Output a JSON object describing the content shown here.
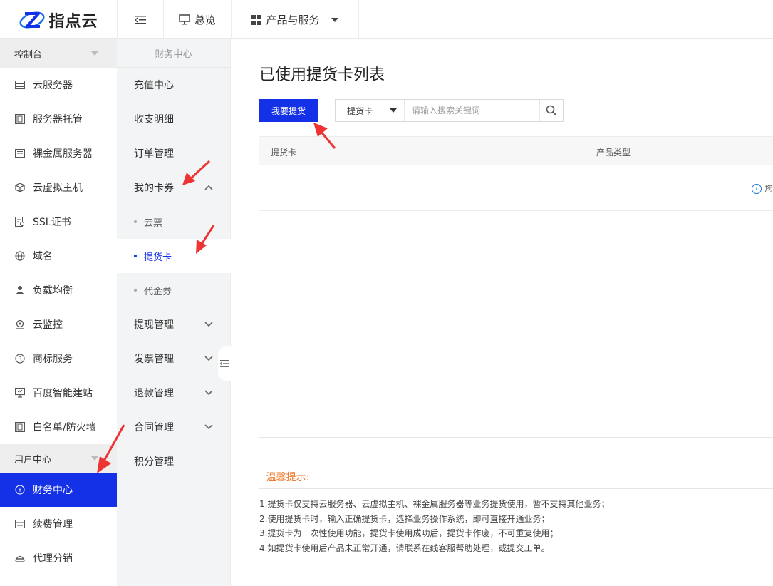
{
  "brand": {
    "name": "指点云"
  },
  "topnav": {
    "overview_label": "总览",
    "products_label": "产品与服务"
  },
  "sidebar": {
    "console_header": "控制台",
    "console_items": [
      {
        "label": "云服务器",
        "icon": "server-icon"
      },
      {
        "label": "服务器托管",
        "icon": "server-hosting-icon"
      },
      {
        "label": "裸金属服务器",
        "icon": "bare-metal-icon"
      },
      {
        "label": "云虚拟主机",
        "icon": "cube-icon"
      },
      {
        "label": "SSL证书",
        "icon": "certificate-icon"
      },
      {
        "label": "域名",
        "icon": "globe-icon"
      },
      {
        "label": "负载均衡",
        "icon": "load-balance-icon"
      },
      {
        "label": "云监控",
        "icon": "monitor-icon"
      },
      {
        "label": "商标服务",
        "icon": "trademark-icon"
      },
      {
        "label": "百度智能建站",
        "icon": "website-icon"
      },
      {
        "label": "白名单/防火墙",
        "icon": "firewall-icon"
      }
    ],
    "user_header": "用户中心",
    "user_items": [
      {
        "label": "财务中心",
        "icon": "finance-icon",
        "active": true
      },
      {
        "label": "续费管理",
        "icon": "renew-icon"
      },
      {
        "label": "代理分销",
        "icon": "agent-icon"
      }
    ]
  },
  "subnav": {
    "title": "财务中心",
    "items": {
      "recharge": "充值中心",
      "billing": "收支明细",
      "orders": "订单管理",
      "coupons": "我的卡券",
      "coupon_children": [
        "云票",
        "提货卡",
        "代金券"
      ],
      "withdraw": "提现管理",
      "invoice": "发票管理",
      "refund": "退款管理",
      "contract": "合同管理",
      "points": "积分管理"
    }
  },
  "main": {
    "title": "已使用提货卡列表",
    "primary_button": "我要提货",
    "search": {
      "select_value": "提货卡",
      "placeholder": "请输入搜索关键词"
    },
    "table": {
      "columns": [
        "提货卡",
        "产品类型"
      ],
      "empty_text": "您"
    },
    "tips": {
      "title": "温馨提示:",
      "lines": [
        "1.提货卡仅支持云服务器、云虚拟主机、裸金属服务器等业务提货使用，暂不支持其他业务；",
        "2.使用提货卡时，输入正确提货卡，选择业务操作系统，即可直接开通业务；",
        "3.提货卡为一次性使用功能，提货卡使用成功后，提货卡作废，不可重复使用；",
        "4.如提货卡使用后产品未正常开通，请联系在线客服帮助处理，或提交工单。"
      ]
    }
  },
  "colors": {
    "primary": "#1431e8",
    "tip_accent": "#f07a2d",
    "annotation_arrow": "#ee3333"
  }
}
